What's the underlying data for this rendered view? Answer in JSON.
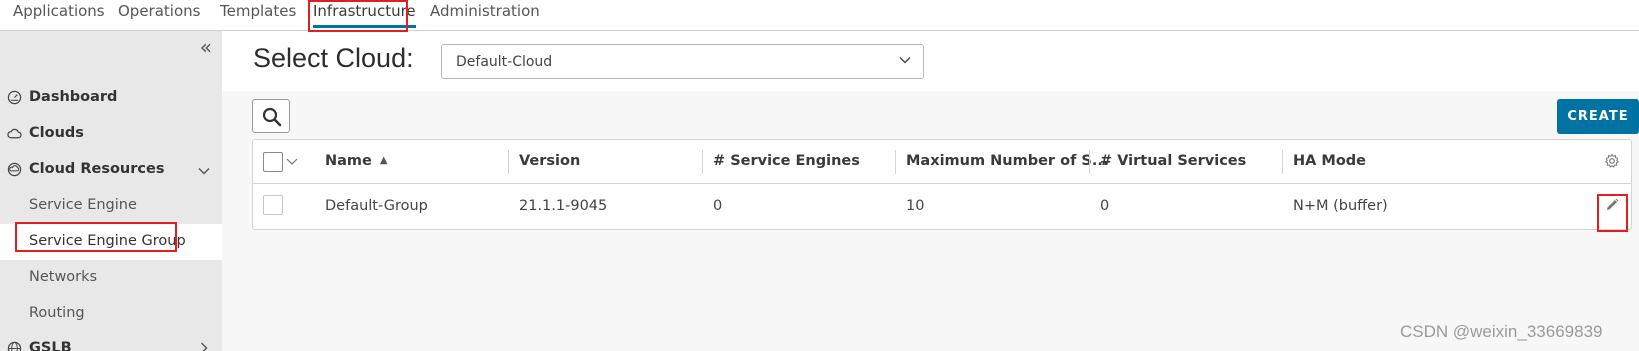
{
  "topnav": {
    "tabs": [
      "Applications",
      "Operations",
      "Templates",
      "Infrastructure",
      "Administration"
    ],
    "active": "Infrastructure"
  },
  "sidebar": {
    "collapse_glyph": "«",
    "items": [
      {
        "label": "Dashboard",
        "icon": "dashboard-icon"
      },
      {
        "label": "Clouds",
        "icon": "cloud-icon"
      },
      {
        "label": "Cloud Resources",
        "icon": "cloud-resources-icon",
        "expanded": true
      }
    ],
    "sub_items": [
      "Service Engine",
      "Service Engine Group",
      "Networks",
      "Routing"
    ],
    "active_sub_item": "Service Engine Group",
    "last_item": {
      "label": "GSLB",
      "icon": "globe-icon"
    }
  },
  "main": {
    "select_label": "Select Cloud:",
    "cloud_value": "Default-Cloud",
    "create_label": "CREATE"
  },
  "table": {
    "columns": [
      "Name",
      "Version",
      "# Service Engines",
      "Maximum Number of S...",
      "# Virtual Services",
      "HA Mode"
    ],
    "sort_column": "Name",
    "sort_direction": "ascending",
    "rows": [
      [
        "Default-Group",
        "21.1.1-9045",
        "0",
        "10",
        "0",
        "N+M (buffer)"
      ]
    ]
  },
  "watermark": "CSDN @weixin_33669839",
  "colors": {
    "accent": "#0072a3",
    "highlight": "#e02020",
    "sidebar_bg": "#e8e8e8"
  }
}
